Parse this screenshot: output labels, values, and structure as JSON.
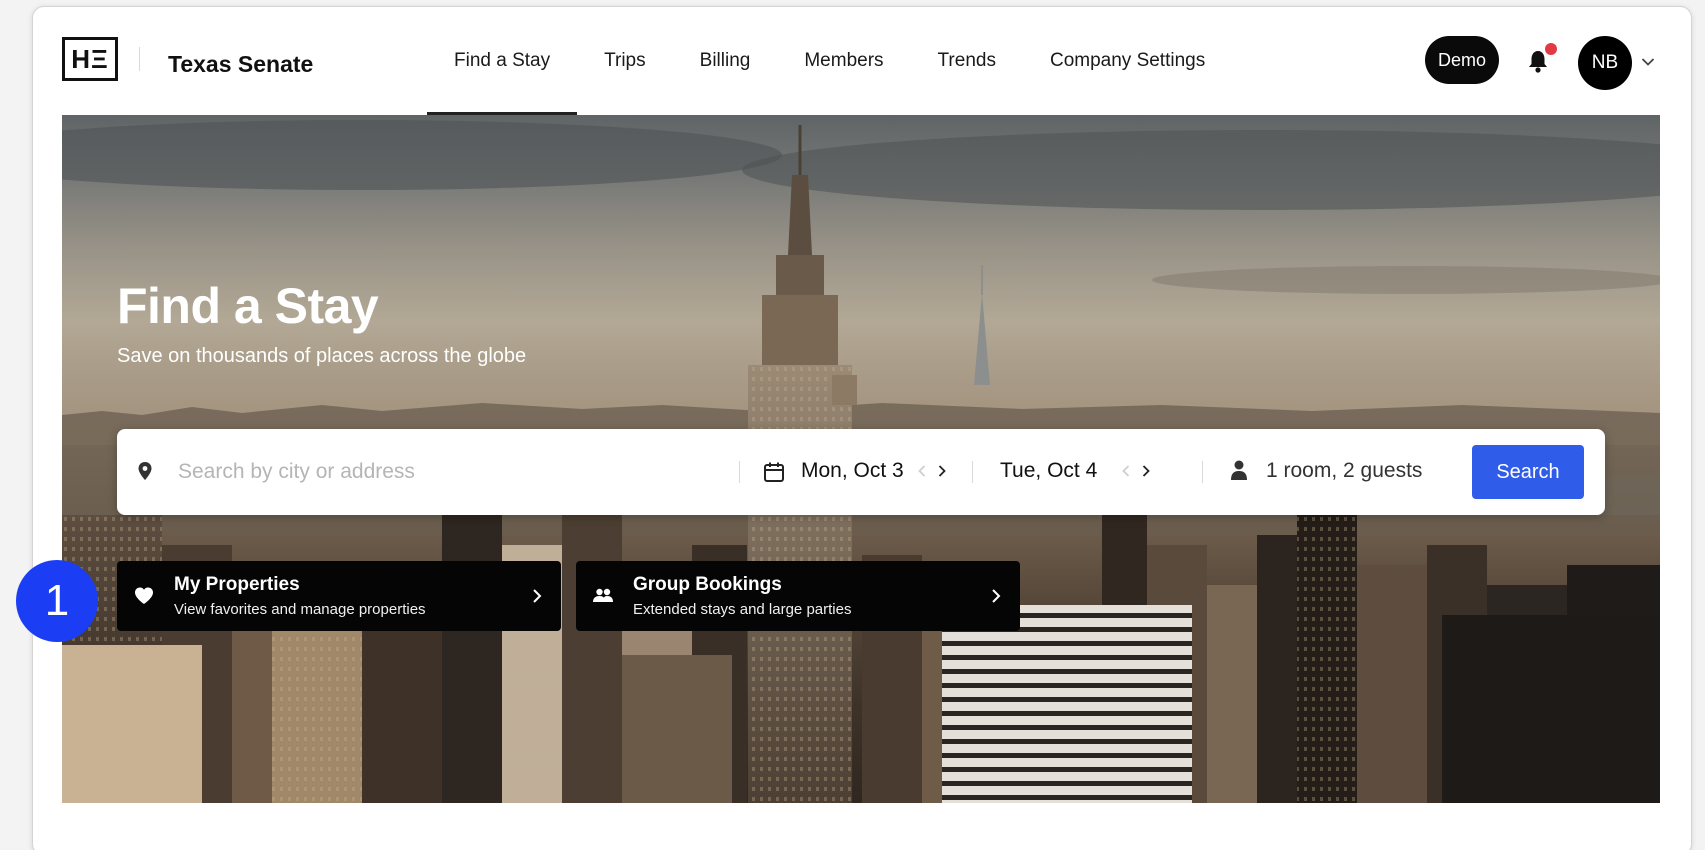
{
  "header": {
    "logo_text": "HΞ",
    "org_name": "Texas Senate",
    "nav": [
      {
        "label": "Find a Stay",
        "active": true
      },
      {
        "label": "Trips",
        "active": false
      },
      {
        "label": "Billing",
        "active": false
      },
      {
        "label": "Members",
        "active": false
      },
      {
        "label": "Trends",
        "active": false
      },
      {
        "label": "Company Settings",
        "active": false
      }
    ],
    "demo_label": "Demo",
    "avatar_initials": "NB",
    "notification_dot": true,
    "icons": {
      "notifications": "bell-icon",
      "account_menu": "chevron-down-icon"
    }
  },
  "hero": {
    "title": "Find a Stay",
    "subtitle": "Save on thousands of places across the globe",
    "background": "city-skyline-photo"
  },
  "search": {
    "placeholder": "Search by city or address",
    "value": "",
    "check_in": "Mon, Oct 3",
    "check_out": "Tue, Oct 4",
    "guests": "1 room, 2 guests",
    "button_label": "Search",
    "icons": {
      "location": "map-pin-icon",
      "date": "calendar-icon",
      "guests": "person-icon"
    }
  },
  "cards": [
    {
      "title": "My Properties",
      "subtitle": "View favorites and manage properties",
      "icon": "heart-icon"
    },
    {
      "title": "Group Bookings",
      "subtitle": "Extended stays and large parties",
      "icon": "group-icon"
    }
  ],
  "step_badge": "1",
  "colors": {
    "accent": "#2f5ce8",
    "step_badge": "#1b3ef5",
    "notification": "#e23a44",
    "card_bg": "#050505"
  }
}
